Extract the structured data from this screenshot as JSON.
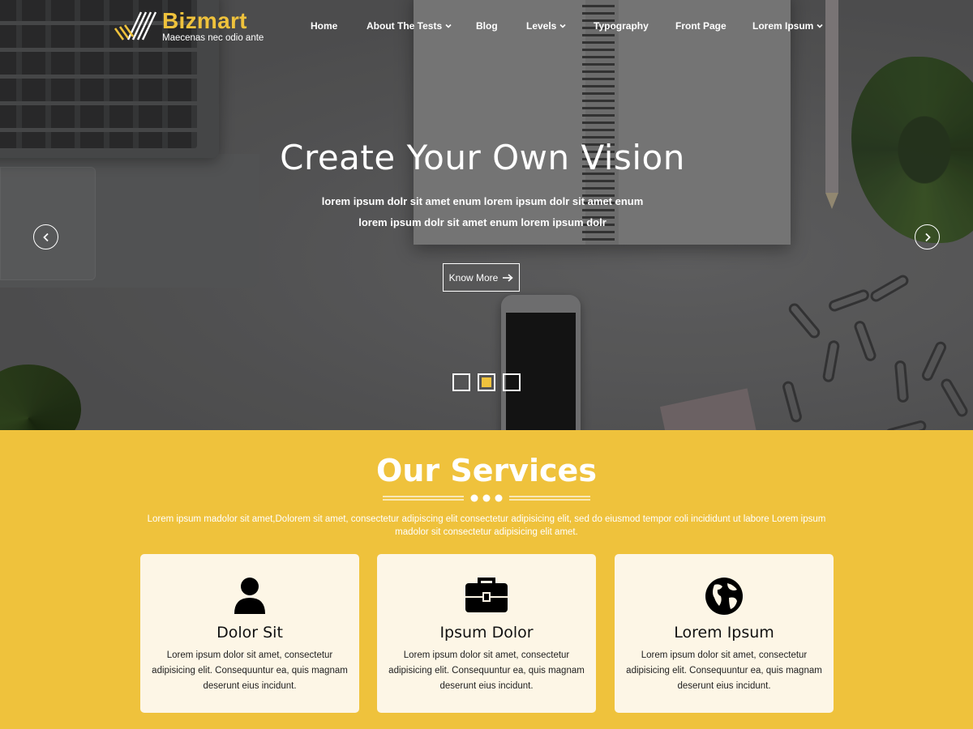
{
  "brand": {
    "name": "Bizmart",
    "tagline": "Maecenas nec odio ante",
    "accent": "#efc23c"
  },
  "nav": {
    "items": [
      {
        "label": "Home",
        "dropdown": false
      },
      {
        "label": "About The Tests",
        "dropdown": true
      },
      {
        "label": "Blog",
        "dropdown": false
      },
      {
        "label": "Levels",
        "dropdown": true
      },
      {
        "label": "Typography",
        "dropdown": false
      },
      {
        "label": "Front Page",
        "dropdown": false
      },
      {
        "label": "Lorem Ipsum",
        "dropdown": true
      }
    ]
  },
  "hero": {
    "title": "Create Your Own Vision",
    "line1": "lorem ipsum dolr sit amet enum lorem ipsum dolr sit amet enum",
    "line2": "lorem ipsum dolr sit amet enum lorem ipsum dolr",
    "button_label": "Know More",
    "prev_icon": "chevron-left-icon",
    "next_icon": "chevron-right-icon",
    "slides": 3,
    "active_slide": 2
  },
  "services": {
    "title": "Our Services",
    "description": "Lorem ipsum madolor sit amet,Dolorem sit amet, consectetur adipiscing elit consectetur adipisicing elit, sed do eiusmod tempor coli incididunt ut labore Lorem ipsum madolor sit consectetur adipisicing elit amet.",
    "cards": [
      {
        "icon": "user-icon",
        "title": "Dolor Sit",
        "text": "Lorem ipsum dolor sit amet, consectetur adipisicing elit. Consequuntur ea, quis magnam deserunt eius incidunt."
      },
      {
        "icon": "briefcase-icon",
        "title": "Ipsum Dolor",
        "text": "Lorem ipsum dolor sit amet, consectetur adipisicing elit. Consequuntur ea, quis magnam deserunt eius incidunt."
      },
      {
        "icon": "globe-icon",
        "title": "Lorem Ipsum",
        "text": "Lorem ipsum dolor sit amet, consectetur adipisicing elit. Consequuntur ea, quis magnam deserunt eius incidunt."
      }
    ]
  }
}
